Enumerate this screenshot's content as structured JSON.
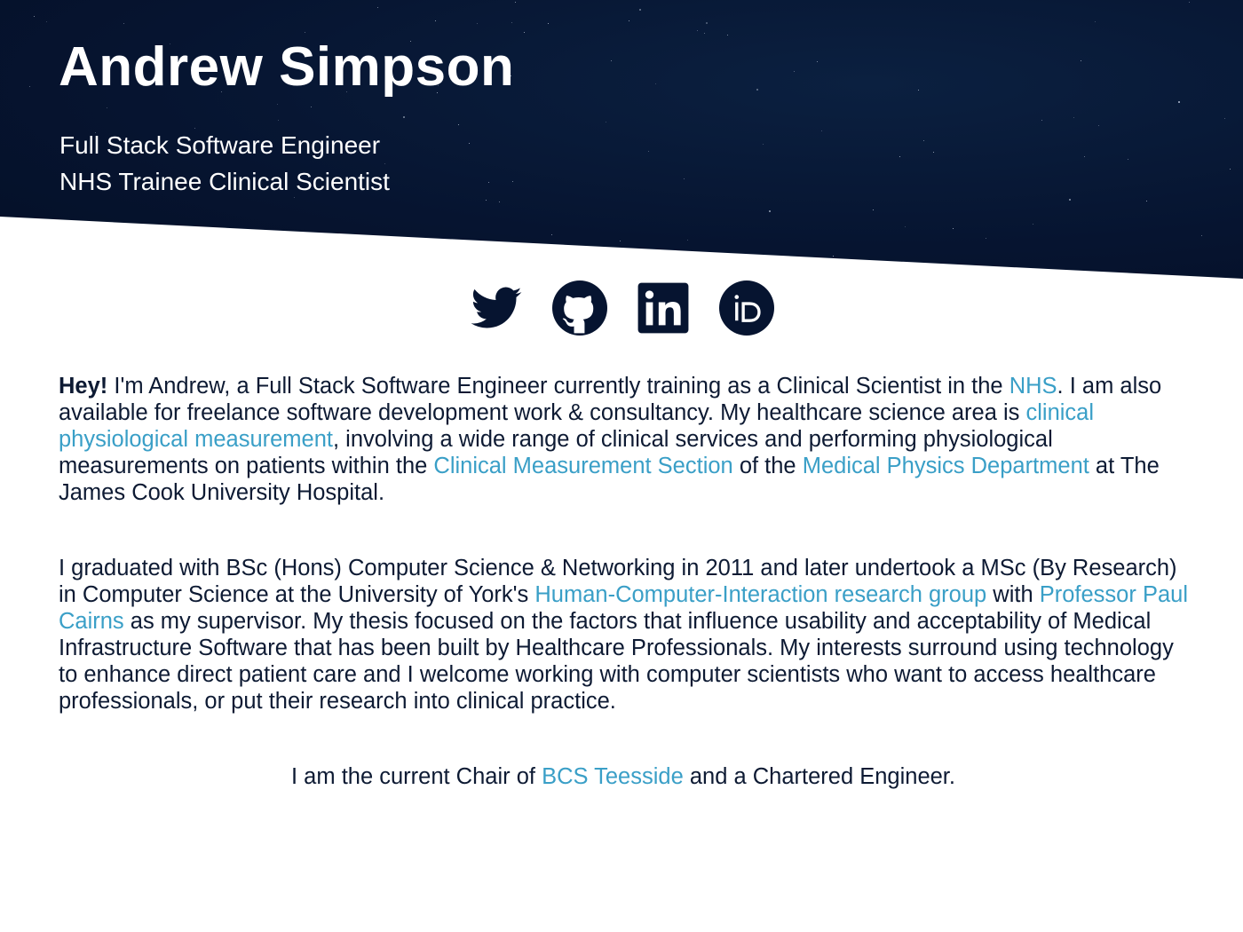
{
  "header": {
    "name": "Andrew Simpson",
    "subtitles": [
      "Full Stack Software Engineer",
      "NHS Trainee Clinical Scientist"
    ]
  },
  "social": [
    {
      "icon": "twitter-icon"
    },
    {
      "icon": "github-icon"
    },
    {
      "icon": "linkedin-icon"
    },
    {
      "icon": "orcid-icon"
    }
  ],
  "colors": {
    "navy": "#061430",
    "link": "#3a9fc7",
    "text": "#0d1a33"
  },
  "p1": {
    "bold": "Hey!",
    "t1": " I'm Andrew, a Full Stack Software Engineer currently training as a Clinical Scientist in the ",
    "l1": "NHS",
    "t2": ". I am also available for freelance software development work & consultancy. My healthcare science area is ",
    "l2": "clinical physiological measurement",
    "t3": ", involving a wide range of clinical services and performing physiological measurements on patients within the ",
    "l3": "Clinical Measurement Section",
    "t4": " of the ",
    "l4": "Medical Physics Department",
    "t5": " at The James Cook University Hospital."
  },
  "p2": {
    "t1": "I graduated with BSc (Hons) Computer Science & Networking in 2011 and later undertook a MSc (By Research) in Computer Science at the University of York's ",
    "l1": "Human-Computer-Interaction research group",
    "t2": " with ",
    "l2": "Professor Paul Cairns",
    "t3": " as my supervisor. My thesis focused on the factors that influence usability and acceptability of Medical Infrastructure Software that has been built by Healthcare Professionals. My interests surround using technology to enhance direct patient care and I welcome working with computer scientists who want to access healthcare professionals, or put their research into clinical practice."
  },
  "p3": {
    "t1": "I am the current Chair of ",
    "l1": "BCS Teesside",
    "t2": " and a Chartered Engineer."
  }
}
